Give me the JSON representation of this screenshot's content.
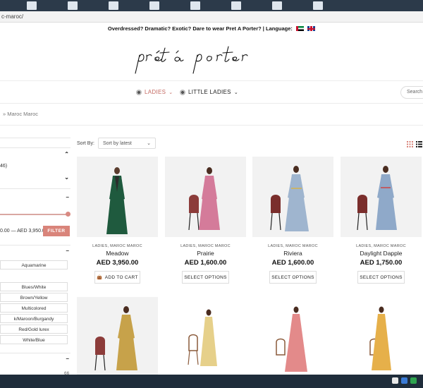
{
  "browser": {
    "url": "c-maroc/"
  },
  "announcement": {
    "text": "Overdressed? Dramatic? Exotic? Dare to wear Pret A Porter? | Language:"
  },
  "nav": {
    "items": [
      {
        "label": "LADIES"
      },
      {
        "label": "LITTLE LADIES"
      }
    ],
    "search_placeholder": "Search"
  },
  "breadcrumb": {
    "text": "» Maroc Maroc"
  },
  "sidebar": {
    "count_text": "46)",
    "price_range": "0.00 — AED 3,950.00",
    "filter_label": "FILTER",
    "colors": [
      "Aquamarine",
      "Blues/White",
      "Brown/Yellow",
      "Multicolored",
      "k/Maroon/Burgandy",
      "Red/Gold lurex",
      "White/Blue"
    ],
    "bottom_count": "66"
  },
  "sort": {
    "label": "Sort By:",
    "selected": "Sort by latest"
  },
  "products": [
    {
      "category": "LADIES, MAROC MAROC",
      "name": "Meadow",
      "price": "AED 3,950.00",
      "button": "ADD TO CART"
    },
    {
      "category": "LADIES, MAROC MAROC",
      "name": "Prairie",
      "price": "AED 1,600.00",
      "button": "SELECT OPTIONS"
    },
    {
      "category": "LADIES, MAROC MAROC",
      "name": "Riviera",
      "price": "AED 1,600.00",
      "button": "SELECT OPTIONS"
    },
    {
      "category": "LADIES, MAROC MAROC",
      "name": "Daylight Dapple",
      "price": "AED 1,750.00",
      "button": "SELECT OPTIONS"
    }
  ],
  "colors": {
    "accent": "#d9847a",
    "nav_active": "#c46a62"
  }
}
